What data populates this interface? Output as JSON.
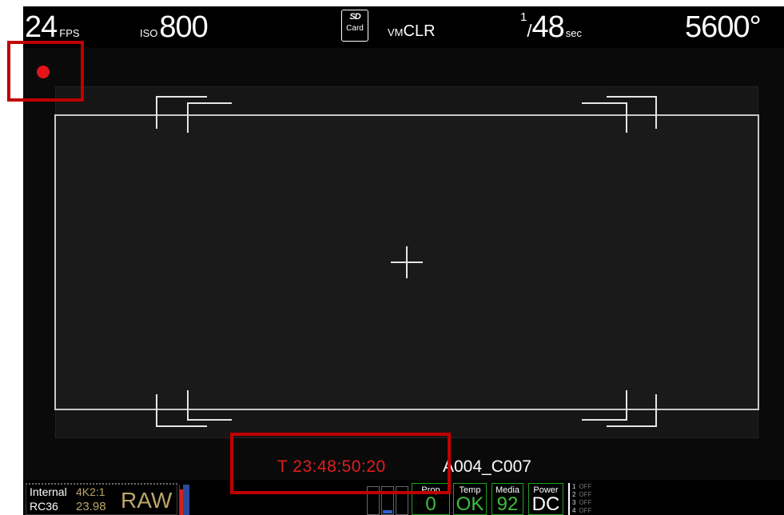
{
  "top_bar": {
    "fps_value": "24",
    "fps_unit": "FPS",
    "iso_label": "ISO",
    "iso_value": "800",
    "sd_logo": "SD",
    "sd_card_label": "Card",
    "vm_prefix": "VM",
    "vm_value": "CLR",
    "shutter_numerator": "1",
    "shutter_denominator": "48",
    "shutter_unit": "sec",
    "white_balance": "5600°"
  },
  "recording": {
    "indicator_color": "#e4141a"
  },
  "timecode": {
    "value": "T 23:48:50:20",
    "color": "#e01e1e"
  },
  "clip": {
    "name": "A004_C007"
  },
  "bottom_bar": {
    "source": "Internal",
    "resolution": "4K2:1",
    "compression": "RC36",
    "frame_rate": "23.98",
    "codec": "RAW",
    "prop": {
      "label": "Prop",
      "value": "0"
    },
    "temp": {
      "label": "Temp",
      "value": "OK"
    },
    "media": {
      "label": "Media",
      "value": "92"
    },
    "power": {
      "label": "Power",
      "value": "DC"
    },
    "tracks": [
      {
        "num": "1",
        "state": "OFF"
      },
      {
        "num": "2",
        "state": "OFF"
      },
      {
        "num": "3",
        "state": "OFF"
      },
      {
        "num": "4",
        "state": "OFF"
      }
    ]
  },
  "annotations": {
    "highlight_color": "#c00000"
  }
}
